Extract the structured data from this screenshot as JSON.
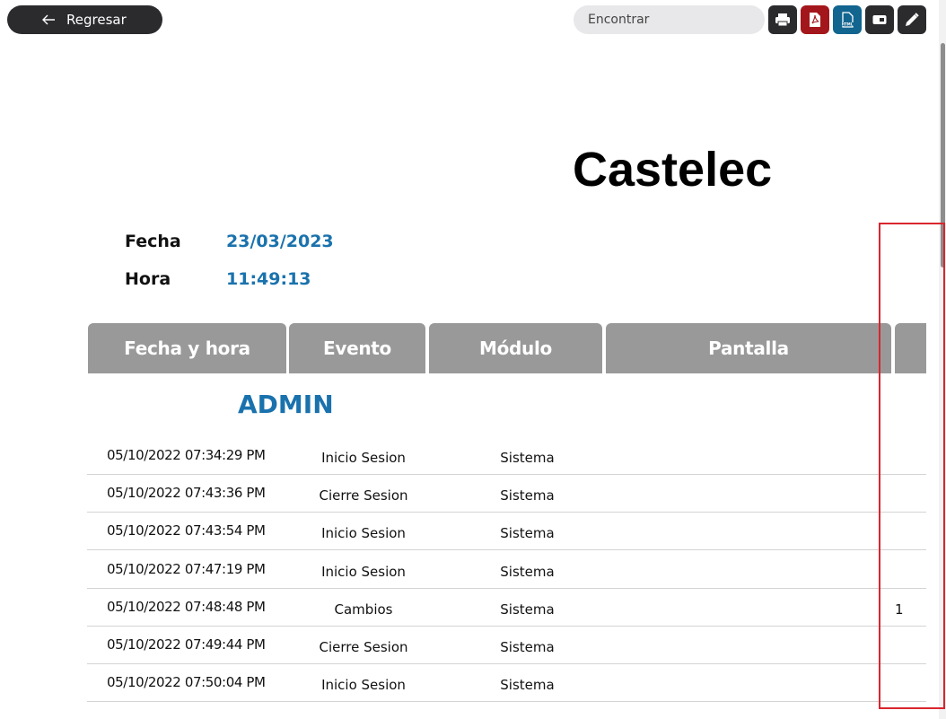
{
  "toolbar": {
    "back_label": "Regresar",
    "search_placeholder": "Encontrar",
    "tools": [
      {
        "name": "print-icon",
        "color": "#2b2b2e"
      },
      {
        "name": "pdf-icon",
        "color": "#a3161b"
      },
      {
        "name": "html-icon",
        "color": "#11658f"
      },
      {
        "name": "screen-icon",
        "color": "#2b2b2e"
      },
      {
        "name": "edit-icon",
        "color": "#2b2b2e"
      }
    ]
  },
  "report": {
    "company": "Castelec",
    "date_label": "Fecha",
    "date_value": "23/03/2023",
    "time_label": "Hora",
    "time_value": "11:49:13",
    "columns": [
      "Fecha y hora",
      "Evento",
      "Módulo",
      "Pantalla",
      ""
    ],
    "user": "ADMIN",
    "rows": [
      {
        "datetime": "05/10/2022 07:34:29 PM",
        "event": "Inicio Sesion",
        "module": "Sistema",
        "extra": ""
      },
      {
        "datetime": "05/10/2022 07:43:36 PM",
        "event": "Cierre Sesion",
        "module": "Sistema",
        "extra": ""
      },
      {
        "datetime": "05/10/2022 07:43:54 PM",
        "event": "Inicio Sesion",
        "module": "Sistema",
        "extra": ""
      },
      {
        "datetime": "05/10/2022 07:47:19 PM",
        "event": "Inicio Sesion",
        "module": "Sistema",
        "extra": ""
      },
      {
        "datetime": "05/10/2022 07:48:48 PM",
        "event": "Cambios",
        "module": "Sistema",
        "extra": "1"
      },
      {
        "datetime": "05/10/2022 07:49:44 PM",
        "event": "Cierre Sesion",
        "module": "Sistema",
        "extra": ""
      },
      {
        "datetime": "05/10/2022 07:50:04 PM",
        "event": "Inicio Sesion",
        "module": "Sistema",
        "extra": ""
      }
    ]
  },
  "colors": {
    "accent_blue": "#1a72ad",
    "header_gray": "#999999",
    "highlight_red": "#d9262e"
  }
}
